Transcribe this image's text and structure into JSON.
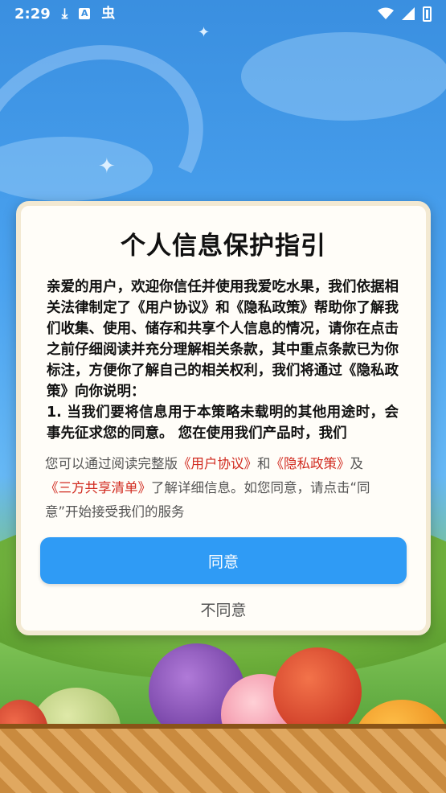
{
  "status_bar": {
    "time": "2:29",
    "download_icon": "download-icon",
    "a_icon_label": "A",
    "app_icon_glyph": "虫",
    "wifi_icon": "wifi-icon",
    "signal_icon": "signal-icon",
    "battery_icon": "battery-icon"
  },
  "dialog": {
    "title": "个人信息保护指引",
    "body": [
      "亲爱的用户，欢迎你信任并使用我爱吃水果，我们依据相关法律制定了《用户协议》和《隐私政策》帮助你了解我们收集、使用、储存和共享个人信息的情况，请你在点击之前仔细阅读并充分理解相关条款，其中重点条款已为你标注，方便你了解自己的相关权利，我们将通过《隐私政策》向你说明：",
      "1. 当我们要将信息用于本策略未载明的其他用途时，会事先征求您的同意。 您在使用我们产品时，我们"
    ],
    "summary": {
      "prefix": "您可以通过阅读完整版",
      "link_user_agreement": "《用户协议》",
      "and": "和",
      "link_privacy_policy": "《隐私政策》",
      "and2": "及",
      "link_third_party": "《三方共享清单》",
      "suffix": "了解详细信息。如您同意，请点击“同意”开始接受我们的服务"
    },
    "agree_label": "同意",
    "disagree_label": "不同意"
  },
  "colors": {
    "agree_button": "#2f9bf5",
    "link": "#d12a1f",
    "dialog_bg": "#fffdf8"
  }
}
